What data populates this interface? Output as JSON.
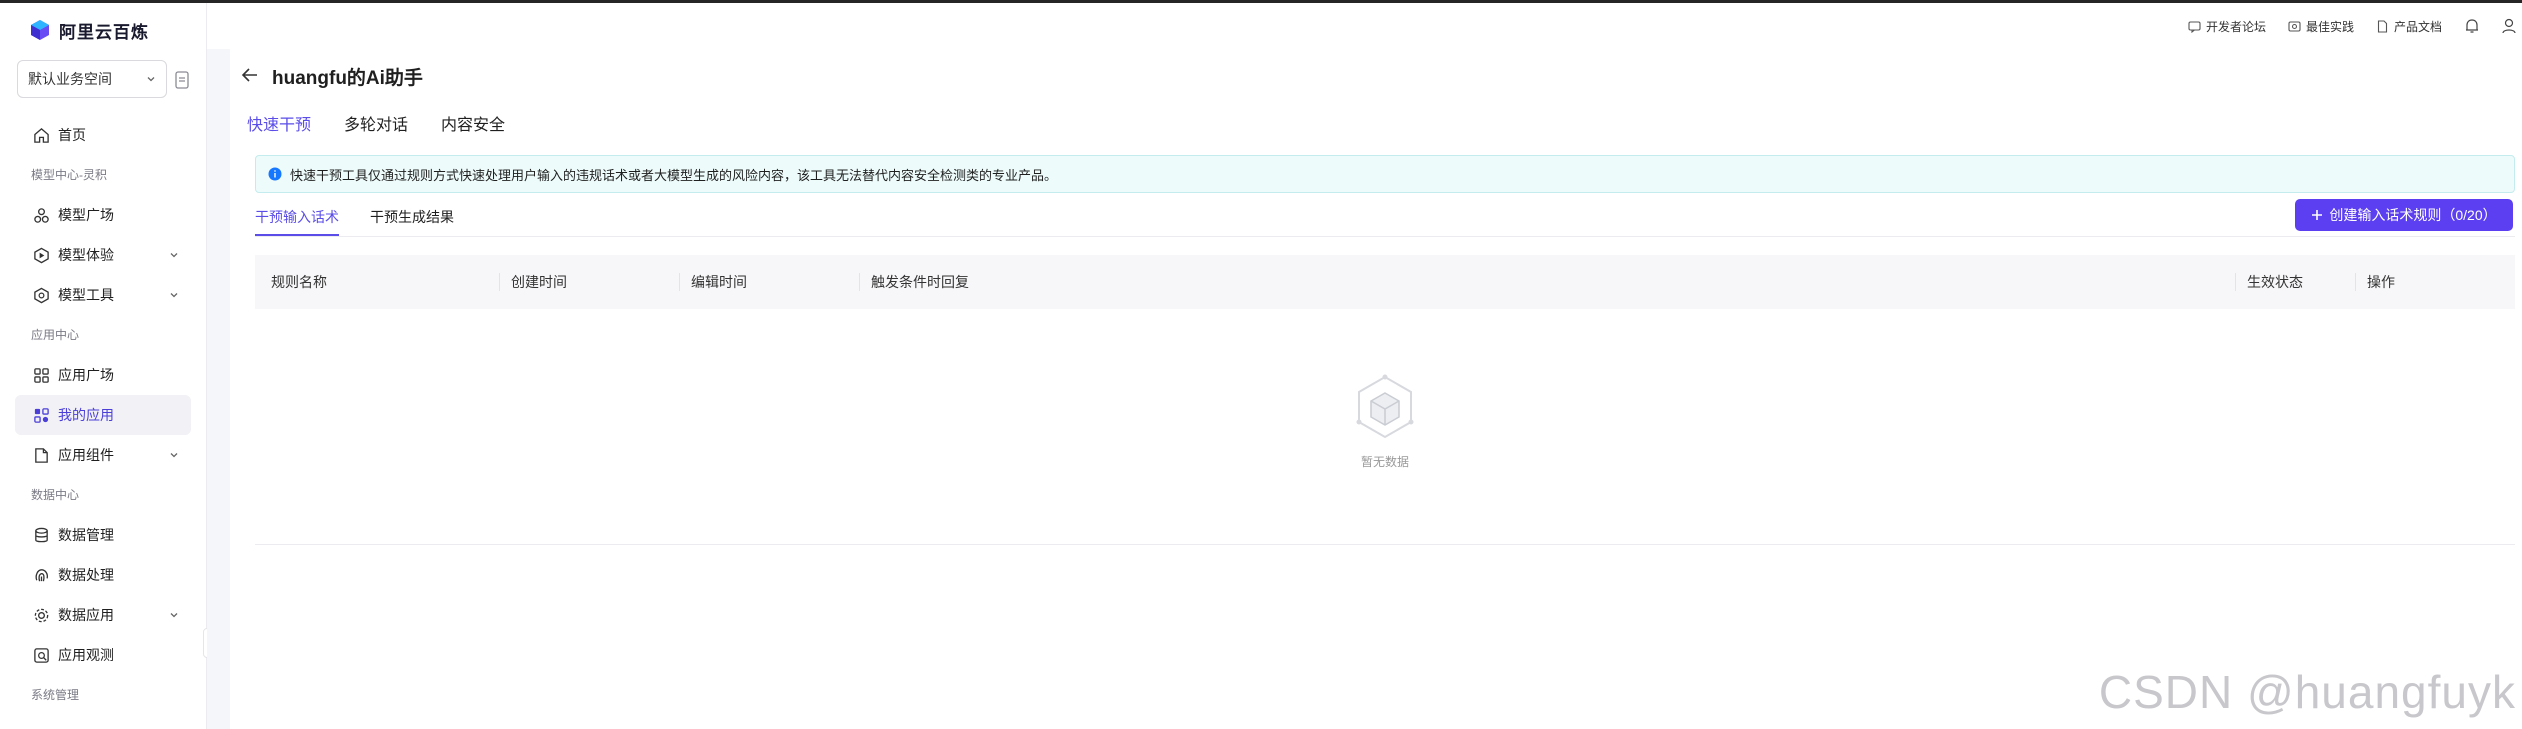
{
  "brand": {
    "name": "阿里云百炼"
  },
  "workspace": {
    "selected": "默认业务空间"
  },
  "sidebar": {
    "home": "首页",
    "section_model": "模型中心-灵积",
    "model_square": "模型广场",
    "model_experience": "模型体验",
    "model_tools": "模型工具",
    "section_app": "应用中心",
    "app_square": "应用广场",
    "my_apps": "我的应用",
    "app_components": "应用组件",
    "section_data": "数据中心",
    "data_management": "数据管理",
    "data_processing": "数据处理",
    "data_apps": "数据应用",
    "app_observe": "应用观测",
    "section_system": "系统管理"
  },
  "topbar": {
    "forum": "开发者论坛",
    "best_practice": "最佳实践",
    "docs": "产品文档"
  },
  "page": {
    "title": "huangfu的Ai助手"
  },
  "tabs": [
    "快速干预",
    "多轮对话",
    "内容安全"
  ],
  "alert": {
    "text": "快速干预工具仅通过规则方式快速处理用户输入的违规话术或者大模型生成的风险内容，该工具无法替代内容安全检测类的专业产品。"
  },
  "subtabs": [
    "干预输入话术",
    "干预生成结果"
  ],
  "create_button": {
    "label": "创建输入话术规则（0/20）"
  },
  "table": {
    "columns": [
      "规则名称",
      "创建时间",
      "编辑时间",
      "触发条件时回复",
      "生效状态",
      "操作"
    ],
    "empty_text": "暂无数据"
  },
  "watermark": "CSDN @huangfuyk",
  "colors": {
    "accent": "#5b4de8",
    "button": "#5b3ff0",
    "alert_bg": "#eefbfb"
  }
}
